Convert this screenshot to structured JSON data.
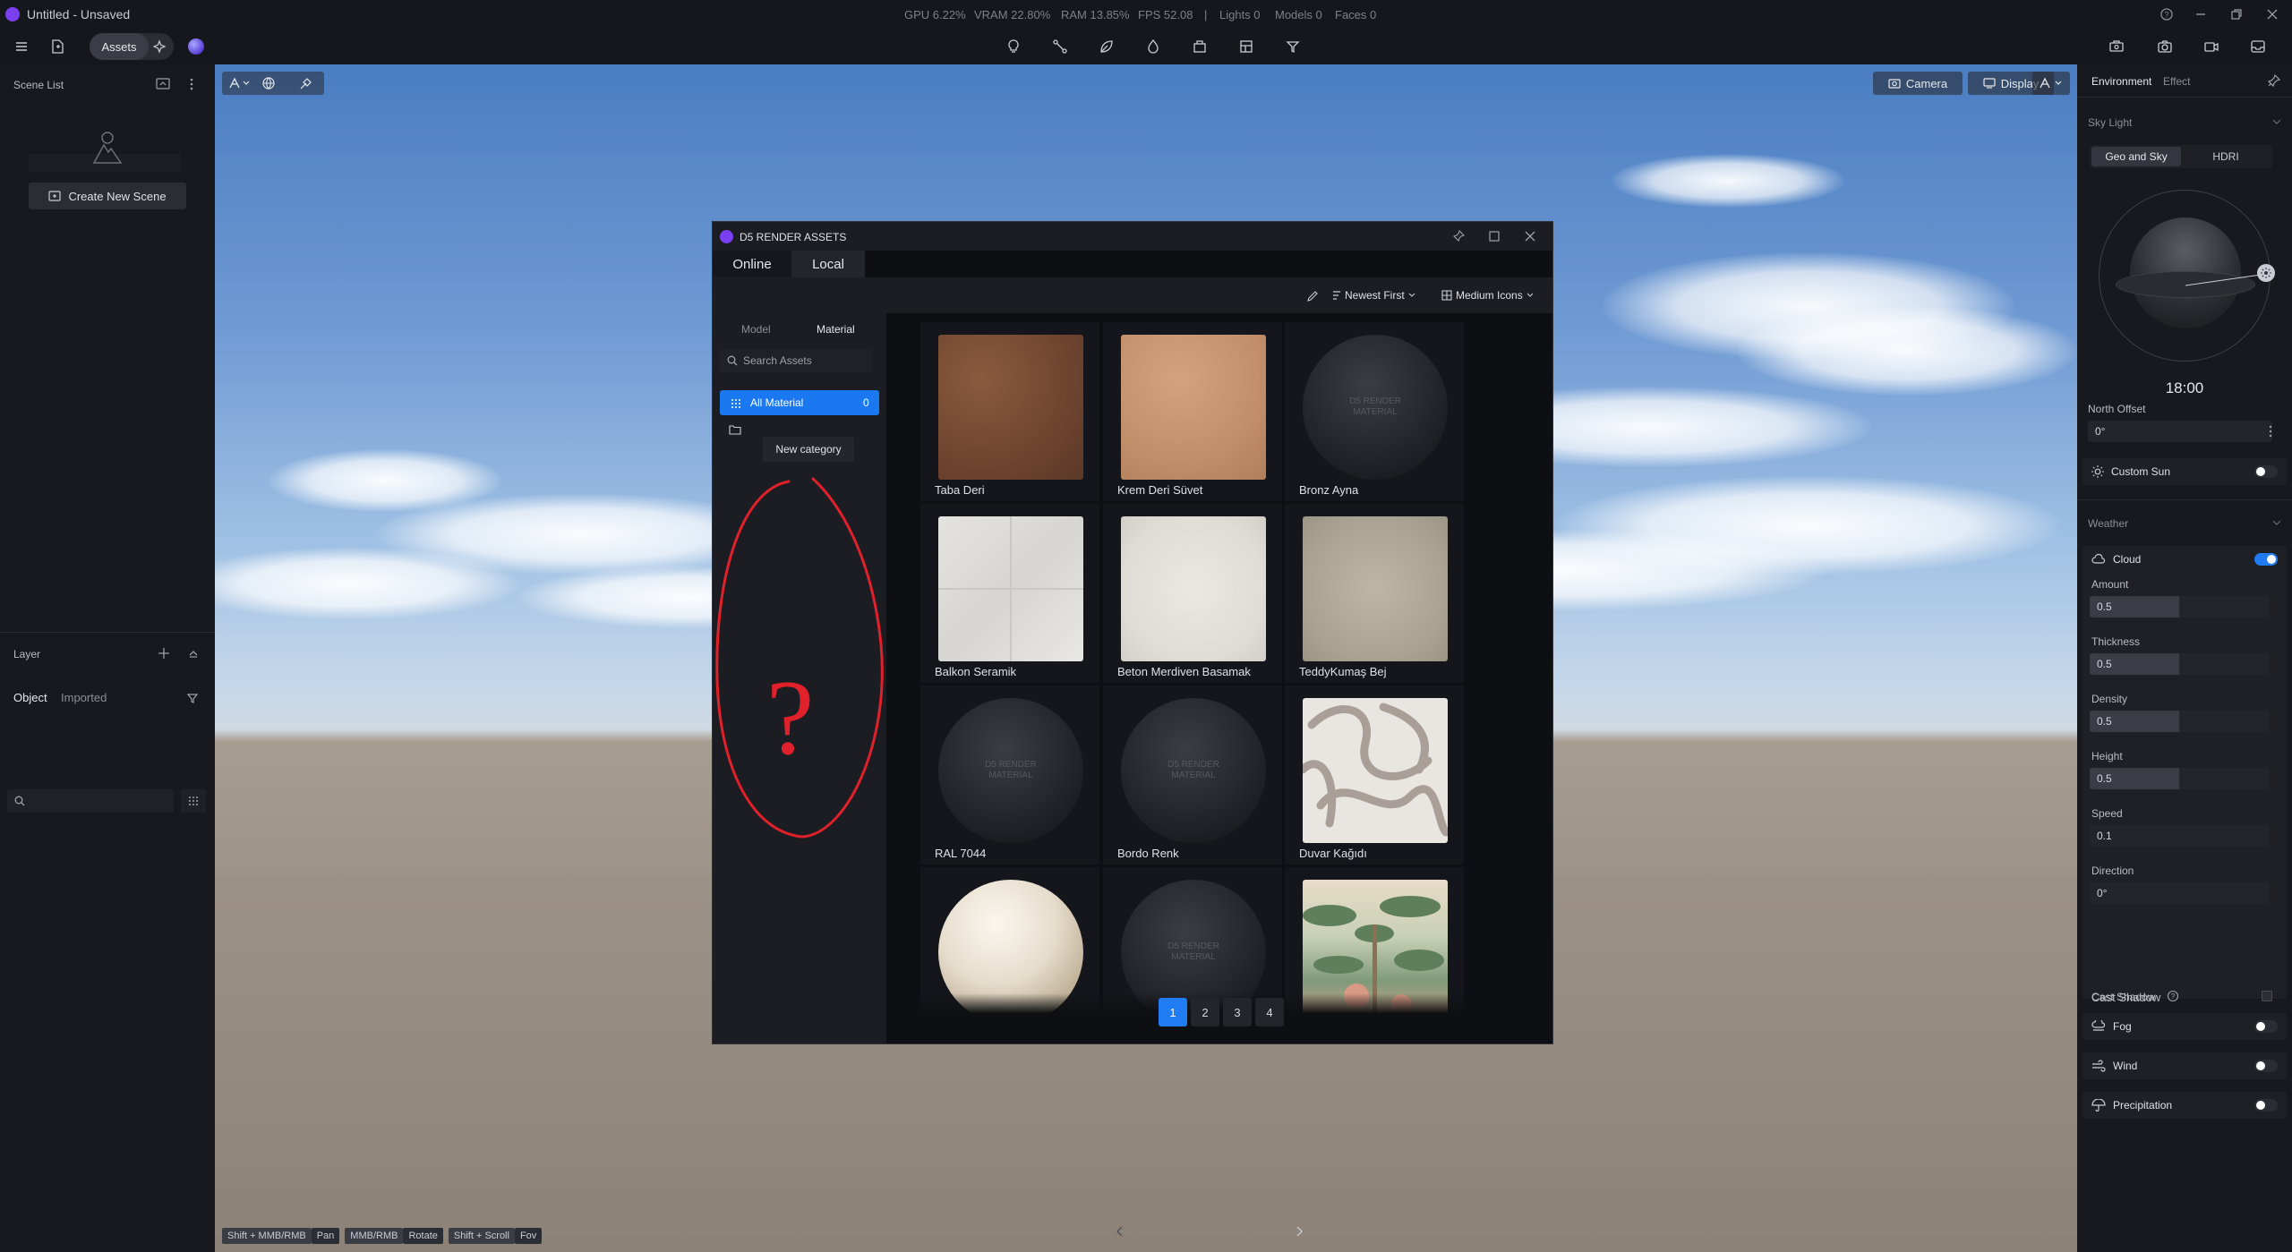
{
  "app": {
    "title": "Untitled - Unsaved"
  },
  "stats": {
    "gpu": "GPU 6.22%",
    "vram": "VRAM 22.80%",
    "ram": "RAM 13.85%",
    "fps": "FPS 52.08",
    "sep": "|",
    "lights": "Lights 0",
    "models": "Models 0",
    "faces": "Faces 0"
  },
  "toolbar": {
    "assets_label": "Assets"
  },
  "left": {
    "scene_list_label": "Scene List",
    "create_scene_label": "Create New Scene",
    "layer_label": "Layer",
    "tab_object": "Object",
    "tab_imported": "Imported"
  },
  "viewport": {
    "camera_label": "Camera",
    "display_label": "Display"
  },
  "shortcuts": [
    {
      "keys": "Shift + MMB/RMB",
      "action": "Pan"
    },
    {
      "keys": "MMB/RMB",
      "action": "Rotate"
    },
    {
      "keys": "Shift + Scroll",
      "action": "Fov"
    }
  ],
  "right": {
    "tab_environment": "Environment",
    "tab_effect": "Effect",
    "sky_light_label": "Sky Light",
    "seg_geo": "Geo and Sky",
    "seg_hdri": "HDRI",
    "time": "18:00",
    "north_offset_label": "North Offset",
    "north_offset_value": "0°",
    "custom_sun_label": "Custom Sun",
    "weather_label": "Weather",
    "cloud_label": "Cloud",
    "amount_label": "Amount",
    "amount_value": "0.5",
    "thickness_label": "Thickness",
    "thickness_value": "0.5",
    "density_label": "Density",
    "density_value": "0.5",
    "height_label": "Height",
    "height_value": "0.5",
    "speed_label": "Speed",
    "speed_value": "0.1",
    "direction_label": "Direction",
    "direction_value": "0°",
    "cast_shadow_label": "Cast Shadow",
    "fog_label": "Fog",
    "wind_label": "Wind",
    "precipitation_label": "Precipitation",
    "cloud_on": true,
    "slider_fill": 0.5
  },
  "dialog": {
    "title": "D5 RENDER ASSETS",
    "tab_online": "Online",
    "tab_local": "Local",
    "sort_label": "Newest First",
    "view_label": "Medium Icons",
    "sub_model": "Model",
    "sub_material": "Material",
    "search_placeholder": "Search Assets",
    "all_material_label": "All Material",
    "all_material_count": "0",
    "new_category_tooltip": "New category",
    "annotation_mark": "?",
    "placeholder_text": "D5 RENDER MATERIAL",
    "pages": [
      "1",
      "2",
      "3",
      "4"
    ],
    "current_page": "1",
    "materials": [
      {
        "name": "Taba Deri",
        "kind": "leather-dark"
      },
      {
        "name": "Krem Deri Süvet",
        "kind": "leather-light"
      },
      {
        "name": "Bronz Ayna",
        "kind": "placeholder"
      },
      {
        "name": "Balkon Seramik",
        "kind": "tile"
      },
      {
        "name": "Beton Merdiven Basamak",
        "kind": "concrete"
      },
      {
        "name": "TeddyKumaş Bej",
        "kind": "fabric"
      },
      {
        "name": "RAL 7044",
        "kind": "placeholder"
      },
      {
        "name": "Bordo Renk",
        "kind": "placeholder"
      },
      {
        "name": "Duvar Kağıdı",
        "kind": "wallpaper"
      },
      {
        "name": "",
        "kind": "marble-sphere"
      },
      {
        "name": "",
        "kind": "placeholder"
      },
      {
        "name": "",
        "kind": "jungle"
      }
    ]
  },
  "colors": {
    "accent": "#1f7cf3",
    "annotation": "#e0202a",
    "panel": "#17191e"
  }
}
